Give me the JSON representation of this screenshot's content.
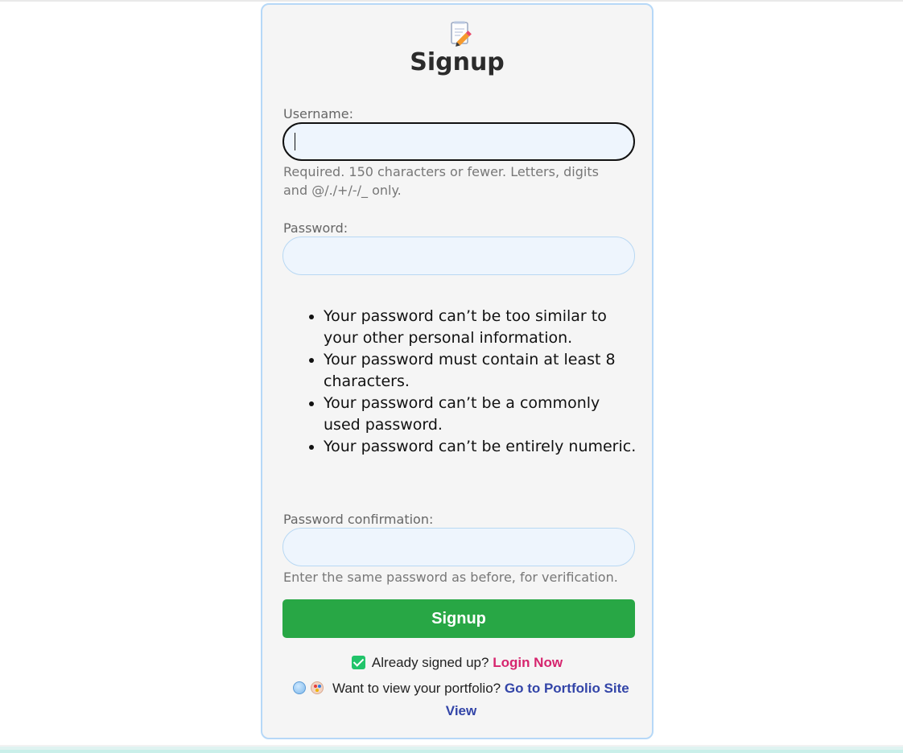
{
  "form": {
    "title": "Signup",
    "logo_icon": "memo-pencil-icon",
    "username": {
      "label": "Username:",
      "value": "",
      "placeholder": "",
      "help": "Required. 150 characters or fewer. Letters, digits and @/./+/-/_ only."
    },
    "password": {
      "label": "Password:",
      "value": "",
      "placeholder": "",
      "rules": [
        "Your password can’t be too similar to your other personal information.",
        "Your password must contain at least 8 characters.",
        "Your password can’t be a commonly used password.",
        "Your password can’t be entirely numeric."
      ]
    },
    "password_confirmation": {
      "label": "Password confirmation:",
      "value": "",
      "placeholder": "",
      "help": "Enter the same password as before, for verification."
    },
    "submit_label": "Signup"
  },
  "footer": {
    "login_prompt": "Already signed up?",
    "login_link": "Login Now",
    "portfolio_prompt": "Want to view your portfolio?",
    "portfolio_link": "Go to Portfolio Site View"
  },
  "colors": {
    "button_green": "#28a745",
    "login_link": "#d6256e",
    "portfolio_link": "#3345a8",
    "card_border": "#b6d8f7"
  }
}
